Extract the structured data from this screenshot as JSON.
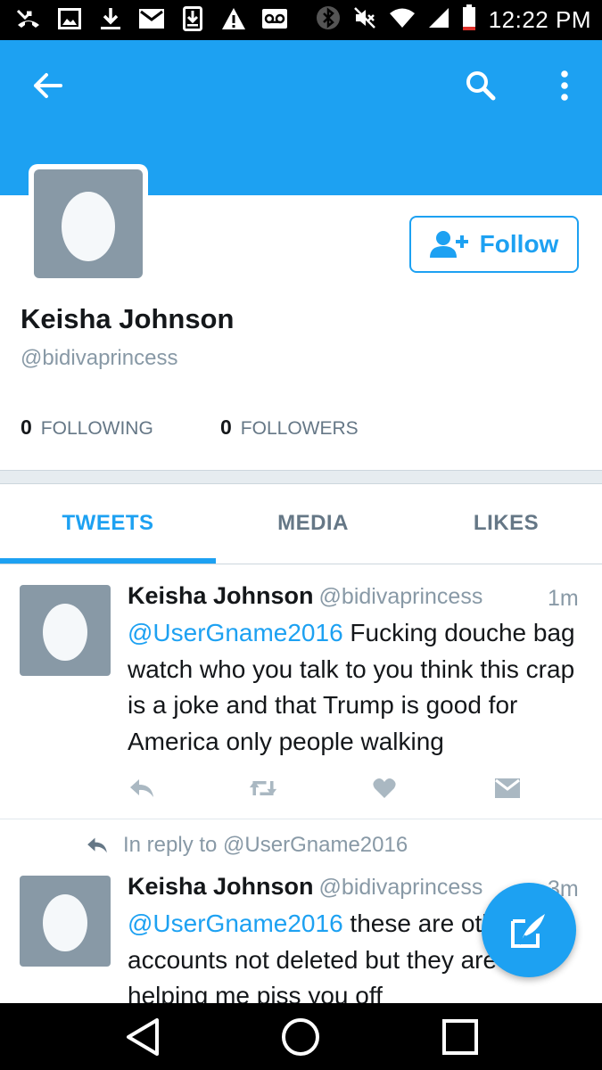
{
  "status_bar": {
    "time": "12:22 PM",
    "left_icons": [
      "missed-call-icon",
      "image-icon",
      "download-icon",
      "email-icon",
      "download-box-icon",
      "warning-icon",
      "voicemail-icon"
    ],
    "right_icons": [
      "bluetooth-icon",
      "mute-icon",
      "wifi-icon",
      "signal-icon",
      "battery-icon"
    ]
  },
  "header": {
    "back_icon": "arrow-left-icon",
    "search_icon": "search-icon",
    "more_icon": "more-vertical-icon",
    "banner_color": "#1da1f2"
  },
  "profile": {
    "name": "Keisha Johnson",
    "handle": "@bidivaprincess",
    "follow_label": "Follow",
    "following_count": "0",
    "following_label": "FOLLOWING",
    "followers_count": "0",
    "followers_label": "FOLLOWERS"
  },
  "tabs": [
    {
      "label": "TWEETS",
      "active": true
    },
    {
      "label": "MEDIA",
      "active": false
    },
    {
      "label": "LIKES",
      "active": false
    }
  ],
  "tweets": [
    {
      "name": "Keisha Johnson",
      "handle": "@bidivaprincess",
      "time": "1m",
      "mention": "@UserGname2016",
      "text": " Fucking douche bag watch who you talk to you think this crap is a joke and that Trump is good for America only people walking"
    },
    {
      "reply_context": "In reply to @UserGname2016",
      "name": "Keisha Johnson",
      "handle": "@bidivaprincess",
      "time": "3m",
      "mention": "@UserGname2016",
      "text": " these are other accounts not deleted but they are helping me piss you off"
    }
  ],
  "fab_icon": "compose-tweet-icon",
  "nav_bar": [
    "back-triangle-icon",
    "home-circle-icon",
    "recents-square-icon"
  ],
  "colors": {
    "accent": "#1da1f2",
    "text": "#14171a",
    "secondary_text": "#8899a6"
  }
}
